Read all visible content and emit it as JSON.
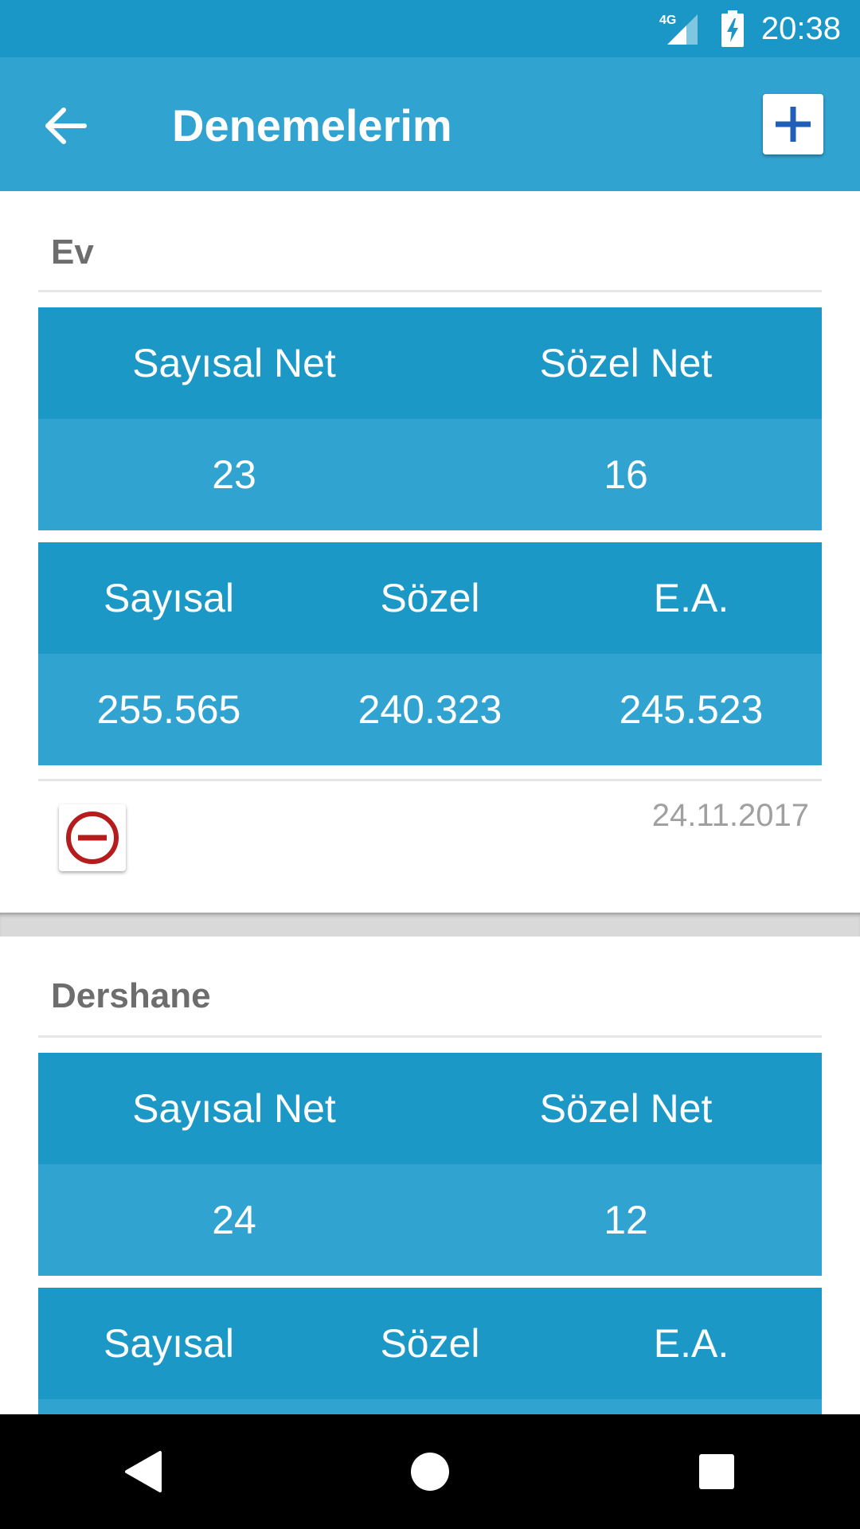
{
  "status_bar": {
    "network": "4G",
    "time": "20:38"
  },
  "app_bar": {
    "back_icon": "arrow-left-icon",
    "title": "Denemelerim",
    "add_icon": "plus-icon"
  },
  "cards": [
    {
      "title": "Ev",
      "net_headers": [
        "Sayısal Net",
        "Sözel Net"
      ],
      "net_values": [
        "23",
        "16"
      ],
      "score_headers": [
        "Sayısal",
        "Sözel",
        "E.A."
      ],
      "score_values": [
        "255.565",
        "240.323",
        "245.523"
      ],
      "date": "24.11.2017",
      "delete_icon": "remove-circle-icon"
    },
    {
      "title": "Dershane",
      "net_headers": [
        "Sayısal Net",
        "Sözel Net"
      ],
      "net_values": [
        "24",
        "12"
      ],
      "score_headers": [
        "Sayısal",
        "Sözel",
        "E.A."
      ]
    }
  ],
  "nav_bar": {
    "back_icon": "triangle-back-icon",
    "home_icon": "circle-home-icon",
    "recents_icon": "square-recents-icon"
  },
  "colors": {
    "status_bar": "#1a97c6",
    "app_bar": "#31a3d1",
    "table_header": "#1c98c7",
    "table_values": "#31a3d1",
    "delete_red": "#b71c1c",
    "add_blue": "#1f5fb5"
  }
}
